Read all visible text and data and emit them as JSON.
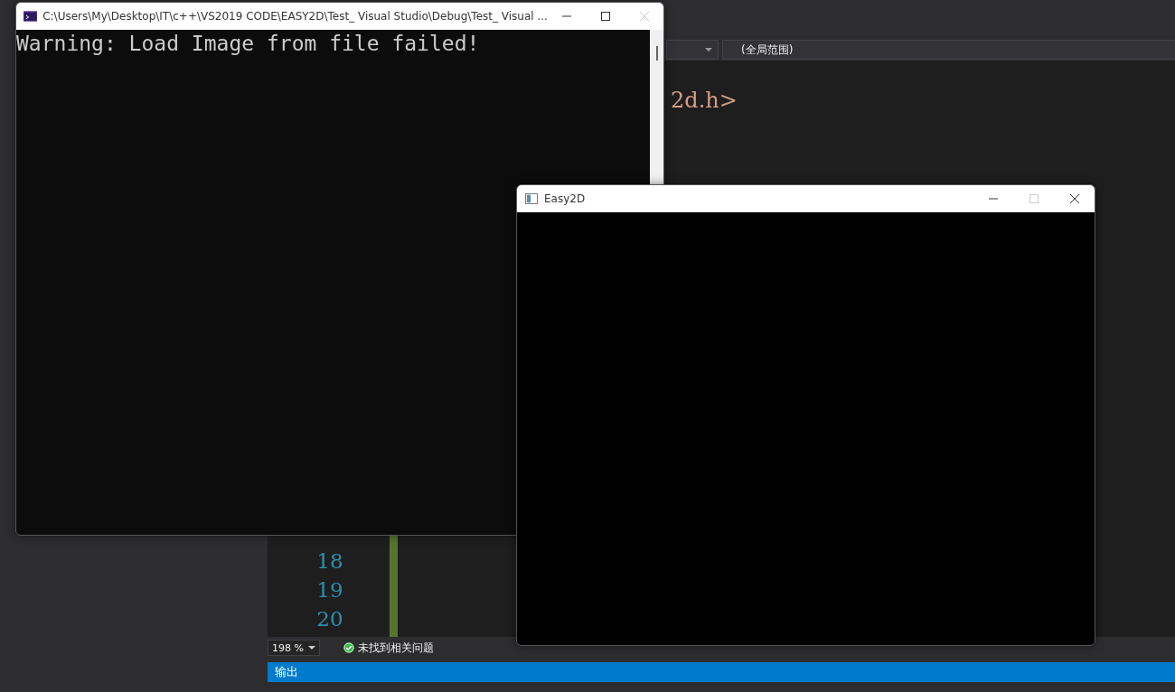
{
  "ide": {
    "scope_dropdown": "(全局范围)",
    "code_lines": [
      "2d.h>"
    ],
    "line_numbers": [
      "18",
      "19",
      "20"
    ],
    "zoom": "198 %",
    "issues": "未找到相关问题",
    "output_panel": {
      "title": "输出"
    }
  },
  "console_window": {
    "title": "C:\\Users\\My\\Desktop\\IT\\c++\\VS2019 CODE\\EASY2D\\Test_ Visual Studio\\Debug\\Test_ Visual ...",
    "output": "Warning: Load Image from file failed!",
    "buttons": [
      {
        "kind": "minimize",
        "disabled": false
      },
      {
        "kind": "maximize",
        "disabled": false
      },
      {
        "kind": "close",
        "disabled": true
      }
    ]
  },
  "easy2d_window": {
    "title": "Easy2D",
    "buttons": [
      {
        "kind": "minimize",
        "disabled": false
      },
      {
        "kind": "maximize",
        "disabled": true
      },
      {
        "kind": "close",
        "disabled": false
      }
    ]
  }
}
